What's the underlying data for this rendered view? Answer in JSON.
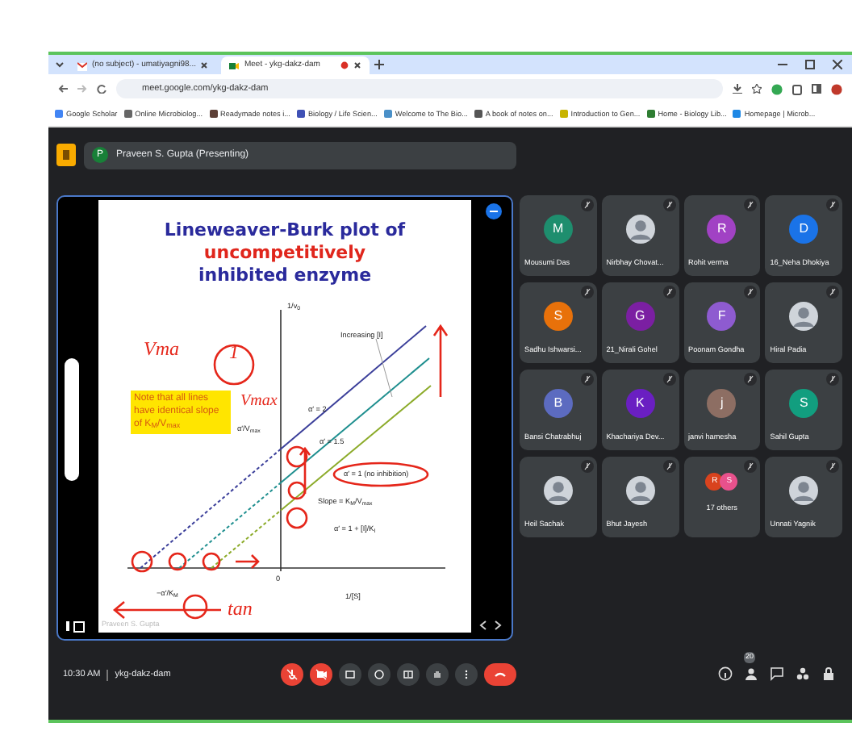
{
  "browser": {
    "tabs": [
      {
        "title": "(no subject) - umatiyagni98...",
        "selected": false,
        "recording": false
      },
      {
        "title": "Meet - ykg-dakz-dam",
        "selected": true,
        "recording": true
      }
    ],
    "url": "meet.google.com/ykg-dakz-dam",
    "bookmarks": [
      "Google Scholar",
      "Online Microbiolog...",
      "Readymade notes i...",
      "Biology / Life Scien...",
      "Welcome to The Bio...",
      "A book of notes on...",
      "Introduction to Gen...",
      "Home - Biology Lib...",
      "Homepage | Microb..."
    ]
  },
  "meet": {
    "presenter": {
      "initial": "P",
      "label": "Praveen S. Gupta (Presenting)"
    },
    "slide": {
      "title_parts": [
        {
          "text": "Lineweaver-Burk plot of",
          "kind": "plain"
        },
        {
          "text": "uncompetitively",
          "kind": "emphasis"
        },
        {
          "text": "inhibited enzyme",
          "kind": "plain"
        }
      ],
      "note": "Note that all lines have identical slope of K$_{M}$/V$_{max}$",
      "labels": [
        "1/v$_{0}$",
        "Increasing [I]",
        "α′ = 2",
        "α′ = 1.5",
        "α′ = 1 (no inhibition)",
        "α′/V$_{max}$",
        "Slope = K$_{M}$/V$_{max}$",
        "α′ = 1 + [I]/K$_{I}$",
        "0",
        "1/[S]",
        "−α′/K$_{M}$"
      ],
      "ink_notes": [
        "Vma",
        "1",
        "Vmax",
        "tan"
      ],
      "caption": "Praveen S. Gupta"
    },
    "participants": [
      {
        "name": "Mousumi Das",
        "kind": "avatar",
        "initial": "M",
        "color": "#1e8e6e"
      },
      {
        "name": "Nirbhay Chovat...",
        "kind": "photo"
      },
      {
        "name": "Rohit verma",
        "kind": "avatar",
        "initial": "R",
        "color": "#a142c4"
      },
      {
        "name": "16_Neha Dhokiya",
        "kind": "avatar",
        "initial": "D",
        "color": "#1a73e8"
      },
      {
        "name": "Sadhu Ishwarsi...",
        "kind": "avatar",
        "initial": "S",
        "color": "#e8710a"
      },
      {
        "name": "21_Nirali Gohel",
        "kind": "avatar",
        "initial": "G",
        "color": "#7b1fa2"
      },
      {
        "name": "Poonam Gondha",
        "kind": "avatar",
        "initial": "F",
        "color": "#8e5bd0"
      },
      {
        "name": "Hiral Padia",
        "kind": "photo"
      },
      {
        "name": "Bansi Chatrabhuj",
        "kind": "avatar",
        "initial": "B",
        "color": "#5c6bc0"
      },
      {
        "name": "Khachariya Dev...",
        "kind": "avatar",
        "initial": "K",
        "color": "#6a1fc2"
      },
      {
        "name": "janvi hamesha",
        "kind": "avatar",
        "initial": "j",
        "color": "#8d6e63"
      },
      {
        "name": "Sahil Gupta",
        "kind": "avatar",
        "initial": "S",
        "color": "#129e7f"
      },
      {
        "name": "Heil Sachak",
        "kind": "photo"
      },
      {
        "name": "Bhut Jayesh",
        "kind": "photo"
      },
      {
        "name": "17 others",
        "kind": "others",
        "initials": [
          "R",
          "S"
        ]
      },
      {
        "name": "Unnati Yagnik",
        "kind": "photo"
      }
    ],
    "bottom": {
      "time": "10:30 AM",
      "code": "ykg-dakz-dam",
      "controls": [
        {
          "kind": "mic",
          "muted": true
        },
        {
          "kind": "camera",
          "muted": true
        },
        {
          "kind": "captions",
          "muted": false
        },
        {
          "kind": "emoji",
          "muted": false
        },
        {
          "kind": "present",
          "muted": false
        },
        {
          "kind": "hand",
          "muted": false
        },
        {
          "kind": "more",
          "muted": false
        },
        {
          "kind": "end",
          "muted": false
        }
      ],
      "people_count": "20"
    }
  }
}
